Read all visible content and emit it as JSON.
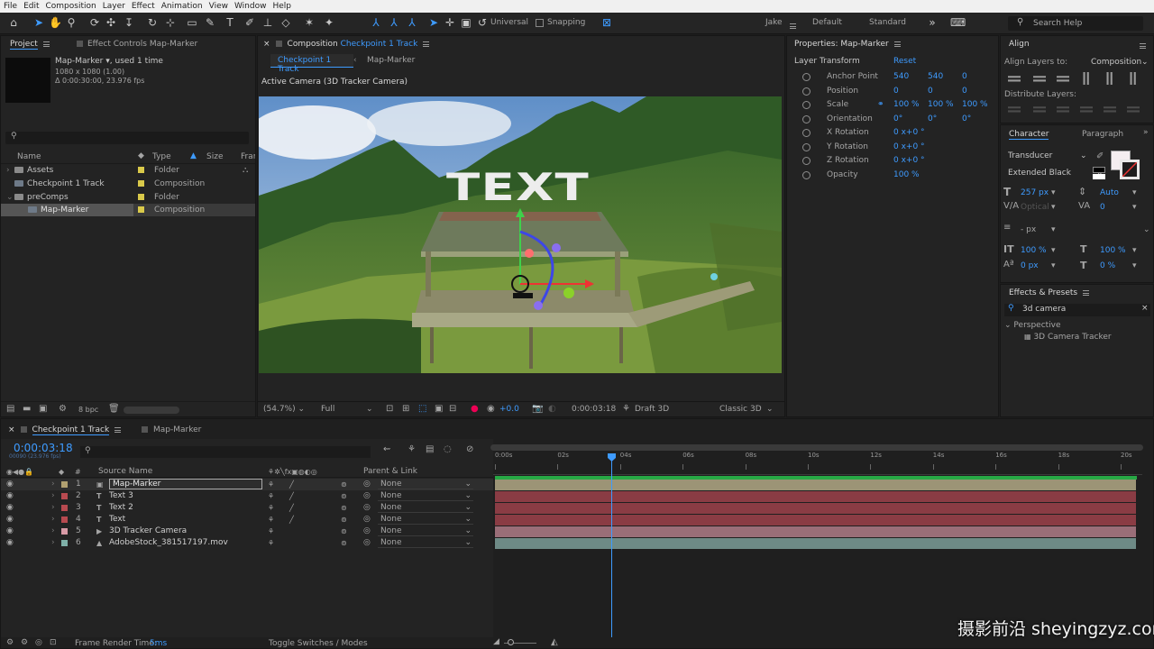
{
  "menu": [
    "File",
    "Edit",
    "Composition",
    "Layer",
    "Effect",
    "Animation",
    "View",
    "Window",
    "Help"
  ],
  "toolbar": {
    "universal_label": "Universal",
    "snapping_label": "Snapping",
    "workspaces": [
      "Jake",
      "Default",
      "Standard"
    ],
    "search_placeholder": "Search Help"
  },
  "project": {
    "tab_project": "Project",
    "tab_effect_controls": "Effect Controls Map-Marker",
    "item_name": "Map-Marker",
    "item_used": ", used 1 time",
    "item_dims": "1080 x 1080 (1.00)",
    "item_duration": "Δ 0:00:30:00, 23.976 fps",
    "col_name": "Name",
    "col_type": "Type",
    "col_size": "Size",
    "col_frame": "Fram",
    "rows": [
      {
        "name": "Assets",
        "type": "Folder",
        "color": "#d9c94a"
      },
      {
        "name": "Checkpoint 1 Track",
        "type": "Composition",
        "color": "#d9c94a"
      },
      {
        "name": "preComps",
        "type": "Folder",
        "color": "#d9c94a"
      },
      {
        "name": "Map-Marker",
        "type": "Composition",
        "color": "#d9c94a"
      }
    ],
    "bpc": "8 bpc"
  },
  "comp": {
    "tab_prefix": "Composition",
    "tab_name": "Checkpoint 1 Track",
    "breadcrumb_active": "Checkpoint 1 Track",
    "breadcrumb_next": "Map-Marker",
    "camera_label": "Active Camera (3D Tracker Camera)",
    "overlay_text": "TEXT",
    "zoom": "(54.7%)",
    "resolution": "Full",
    "exposure": "+0.0",
    "timecode": "0:00:03:18",
    "renderer": "Draft 3D",
    "renderer_mode": "Classic 3D"
  },
  "properties": {
    "title": "Properties: Map-Marker",
    "section": "Layer Transform",
    "reset": "Reset",
    "rows": [
      {
        "label": "Anchor Point",
        "v1": "540",
        "v2": "540",
        "v3": "0"
      },
      {
        "label": "Position",
        "v1": "0",
        "v2": "0",
        "v3": "0"
      },
      {
        "label": "Scale",
        "v1": "100 %",
        "v2": "100 %",
        "v3": "100 %"
      },
      {
        "label": "Orientation",
        "v1": "0°",
        "v2": "0°",
        "v3": "0°"
      },
      {
        "label": "X Rotation",
        "v1": "0 x+0 °",
        "v2": "",
        "v3": ""
      },
      {
        "label": "Y Rotation",
        "v1": "0 x+0 °",
        "v2": "",
        "v3": ""
      },
      {
        "label": "Z Rotation",
        "v1": "0 x+0 °",
        "v2": "",
        "v3": ""
      },
      {
        "label": "Opacity",
        "v1": "100 %",
        "v2": "",
        "v3": ""
      }
    ]
  },
  "align": {
    "title": "Align",
    "layers_to_label": "Align Layers to:",
    "layers_to_value": "Composition",
    "distribute_label": "Distribute Layers:"
  },
  "character": {
    "tab_character": "Character",
    "tab_paragraph": "Paragraph",
    "font": "Transducer",
    "style": "Extended Black",
    "size": "257 px",
    "leading": "Auto",
    "kerning": "Optical",
    "tracking": "0",
    "stroke": "- px",
    "vscale": "100 %",
    "hscale": "100 %",
    "baseline": "0 px",
    "tsume": "0 %"
  },
  "effects": {
    "title": "Effects & Presets",
    "search": "3d camera",
    "category": "Perspective",
    "effect": "3D Camera Tracker"
  },
  "timeline": {
    "tab_active": "Checkpoint 1 Track",
    "tab_other": "Map-Marker",
    "timecode": "0:00:03:18",
    "timecode_sub": "00090 (23.976 fps)",
    "col_source": "Source Name",
    "col_parent": "Parent & Link",
    "layers": [
      {
        "num": "1",
        "name": "Map-Marker",
        "parent": "None",
        "color": "#b0a070",
        "bar": "#9c9476"
      },
      {
        "num": "2",
        "name": "Text 3",
        "parent": "None",
        "color": "#b84a50",
        "bar": "#8a3c44"
      },
      {
        "num": "3",
        "name": "Text 2",
        "parent": "None",
        "color": "#b84a50",
        "bar": "#8a3c44"
      },
      {
        "num": "4",
        "name": "Text",
        "parent": "None",
        "color": "#b84a50",
        "bar": "#8a3c44"
      },
      {
        "num": "5",
        "name": "3D Tracker Camera",
        "parent": "None",
        "color": "#d89aa6",
        "bar": "#9a6e78"
      },
      {
        "num": "6",
        "name": "AdobeStock_381517197.mov",
        "parent": "None",
        "color": "#7fb0a8",
        "bar": "#6e8a86"
      }
    ],
    "ticks": [
      "0:00s",
      "02s",
      "04s",
      "06s",
      "08s",
      "10s",
      "12s",
      "14s",
      "16s",
      "18s",
      "20s"
    ],
    "frame_render_label": "Frame Render Time:",
    "frame_render_value": "5ms",
    "toggle_label": "Toggle Switches / Modes"
  },
  "watermark": "摄影前沿 sheyingzyz.com"
}
